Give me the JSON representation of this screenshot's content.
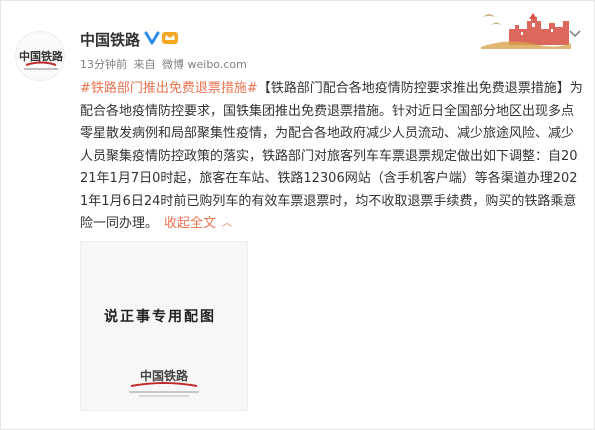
{
  "post": {
    "author": "中国铁路",
    "time": "13分钟前",
    "source_prefix": "来自",
    "source": "微博 weibo.com",
    "topic": "#铁路部门推出免费退票措施#",
    "body": "【铁路部门配合各地疫情防控要求推出免费退票措施】为配合各地疫情防控要求，国铁集团推出免费退票措施。针对近日全国部分地区出现多点零星散发病例和局部聚集性疫情，为配合各地政府减少人员流动、减少旅途风险、减少人员聚集疫情防控政策的落实，铁路部门对旅客列车车票退票规定做出如下调整：自2021年1月7日0时起，旅客在车站、铁路12306网站（含手机客户端）等各渠道办理2021年1月6日24时前已购列车的有效车票退票时，均不收取退票手续费，购买的铁路乘意险一同办理。",
    "collapse_label": "收起全文",
    "collapse_arrow": "︿",
    "image_caption": "说正事专用配图",
    "avatar_text": "中国铁路",
    "media_logo_text": "中国铁路"
  },
  "icons": {
    "verify": "verified-badge-icon",
    "vip": "vip-crown-icon",
    "more": "chevron-down-icon",
    "banner": "great-wall-icon"
  },
  "colors": {
    "accent": "#eb7350",
    "verify_blue": "#2d8cf0",
    "vip_orange": "#f5a623"
  }
}
